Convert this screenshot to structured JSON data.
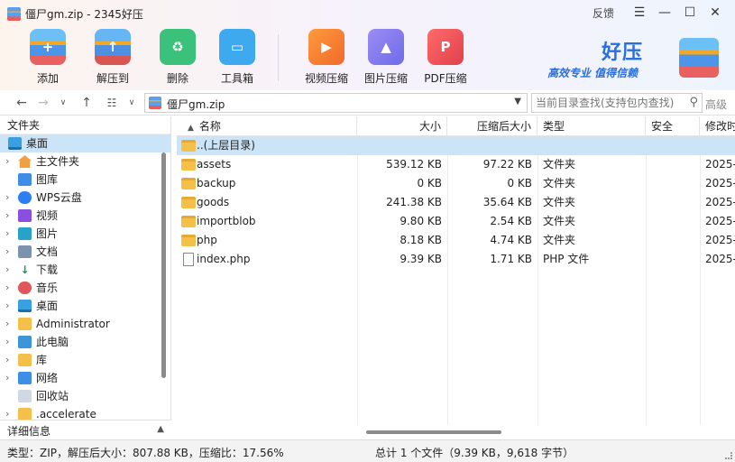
{
  "window": {
    "title": "僵尸gm.zip - 2345好压",
    "feedback": "反馈",
    "menu_icon": "☰",
    "min_icon": "—",
    "max_icon": "☐",
    "close_icon": "✕"
  },
  "toolbar": {
    "add": "添加",
    "extract": "解压到",
    "delete": "删除",
    "toolbox": "工具箱",
    "video": "视频压缩",
    "image": "图片压缩",
    "pdf": "PDF压缩"
  },
  "brand": {
    "name": "好压",
    "slogan": "高效专业  值得信赖"
  },
  "address": {
    "path": "僵尸gm.zip",
    "search_placeholder": "当前目录查找(支持包内查找)",
    "advanced": "高级"
  },
  "sidebar": {
    "header": "文件夹",
    "items": [
      {
        "label": "桌面",
        "icon": "desktop-icon"
      },
      {
        "label": "主文件夹",
        "icon": "home-icon"
      },
      {
        "label": "图库",
        "icon": "gallery-icon"
      },
      {
        "label": "WPS云盘",
        "icon": "cloud-icon"
      },
      {
        "label": "视频",
        "icon": "video-icon"
      },
      {
        "label": "图片",
        "icon": "picture-icon"
      },
      {
        "label": "文档",
        "icon": "document-icon"
      },
      {
        "label": "下载",
        "icon": "download-icon"
      },
      {
        "label": "音乐",
        "icon": "music-icon"
      },
      {
        "label": "桌面",
        "icon": "desktop-icon"
      },
      {
        "label": "Administrator",
        "icon": "folder-icon"
      },
      {
        "label": "此电脑",
        "icon": "computer-icon"
      },
      {
        "label": "库",
        "icon": "folder-icon"
      },
      {
        "label": "网络",
        "icon": "network-icon"
      },
      {
        "label": "回收站",
        "icon": "recycle-bin-icon"
      },
      {
        "label": ".accelerate",
        "icon": "folder-icon"
      }
    ],
    "detail": "详细信息"
  },
  "columns": {
    "name": "名称",
    "size": "大小",
    "packed": "压缩后大小",
    "type": "类型",
    "security": "安全",
    "modified": "修改时"
  },
  "files": [
    {
      "name": "..(上层目录)",
      "size": "",
      "packed": "",
      "type": "",
      "modified": "",
      "kind": "folder"
    },
    {
      "name": "assets",
      "size": "539.12 KB",
      "packed": "97.22 KB",
      "type": "文件夹",
      "modified": "2025-",
      "kind": "folder"
    },
    {
      "name": "backup",
      "size": "0 KB",
      "packed": "0 KB",
      "type": "文件夹",
      "modified": "2025-",
      "kind": "folder"
    },
    {
      "name": "goods",
      "size": "241.38 KB",
      "packed": "35.64 KB",
      "type": "文件夹",
      "modified": "2025-",
      "kind": "folder"
    },
    {
      "name": "importblob",
      "size": "9.80 KB",
      "packed": "2.54 KB",
      "type": "文件夹",
      "modified": "2025-",
      "kind": "folder"
    },
    {
      "name": "php",
      "size": "8.18 KB",
      "packed": "4.74 KB",
      "type": "文件夹",
      "modified": "2025-",
      "kind": "folder"
    },
    {
      "name": "index.php",
      "size": "9.39 KB",
      "packed": "1.71 KB",
      "type": "PHP 文件",
      "modified": "2025-",
      "kind": "file"
    }
  ],
  "status": {
    "left": "类型：ZIP，解压后大小：807.88 KB，压缩比：17.56%",
    "middle": "总计 1 个文件（9.39 KB，9,618 字节）"
  }
}
